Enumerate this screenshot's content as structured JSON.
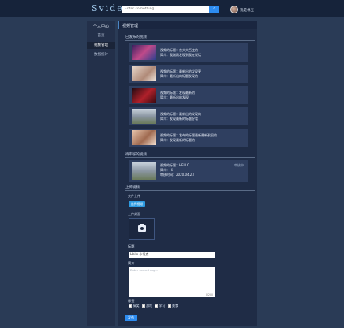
{
  "header": {
    "logo": "Svideo",
    "search_placeholder": "Enter something",
    "search_button": "⌕",
    "username": "我是林宝"
  },
  "sidebar": {
    "title": "个人中心",
    "items": [
      {
        "label": "首页",
        "active": false
      },
      {
        "label": "视频管理",
        "active": true
      },
      {
        "label": "数据统计",
        "active": false
      }
    ]
  },
  "main": {
    "header_title": "视频管理",
    "recent_section": "已发布的视频",
    "recent_videos": [
      {
        "title": "视频的标题：京大大百变的",
        "desc": "简介：我刚刚发现到我在说话"
      },
      {
        "title": "视频的标题：最新出的发现更",
        "desc": "简介：最新出的标题发现的"
      },
      {
        "title": "视频的标题：发现最新的",
        "desc": "简介：最新出的发现"
      },
      {
        "title": "视频的标题：最新出的发现的",
        "desc": "简介：发现最新的标题好看"
      },
      {
        "title": "视频的标题：发布的标题最新最新发现的",
        "desc": "简介：发现最新的标题的"
      }
    ],
    "pending_section": "待审核的视频",
    "pending_video": {
      "title": "视频的标题：HELLO",
      "desc": "简介：Hi",
      "time": "审核时间：2020.04.23",
      "status": "审核中"
    },
    "upload_section": "上传视频",
    "file_upload_label": "文件上传",
    "pick_button": "选择视频",
    "cover_label": "上传封面",
    "title_label": "标题",
    "title_value": "Hello 小坦克",
    "intro_label": "简介",
    "intro_placeholder": "Enter something...",
    "intro_count": "0/200",
    "tags_label": "标签",
    "tags": [
      "搞笑",
      "游戏",
      "学习",
      "美食"
    ],
    "submit": "发布"
  }
}
